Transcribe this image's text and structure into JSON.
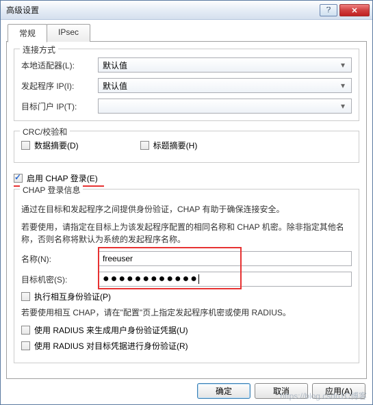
{
  "window": {
    "title": "高级设置"
  },
  "tabs": {
    "t1": "常规",
    "t2": "IPsec"
  },
  "connect": {
    "legend": "连接方式",
    "adapter_label": "本地适配器(L):",
    "initiator_label": "发起程序 IP(I):",
    "target_label": "目标门户 IP(T):",
    "default_value": "默认值"
  },
  "crc": {
    "legend": "CRC/校验和",
    "data_digest": "数据摘要(D)",
    "header_digest": "标题摘要(H)"
  },
  "chap": {
    "enable": "启用 CHAP 登录(E)",
    "group_legend": "CHAP 登录信息",
    "desc1": "通过在目标和发起程序之间提供身份验证，CHAP 有助于确保连接安全。",
    "desc2": "若要使用，请指定在目标上为该发起程序配置的相同名称和 CHAP 机密。除非指定其他名称，否则名称将默认为系统的发起程序名称。",
    "name_label": "名称(N):",
    "name_value": "freeuser",
    "secret_label": "目标机密(S):",
    "secret_value": "●●●●●●●●●●●●",
    "mutual": "执行相互身份验证(P)",
    "mutual_desc": "若要使用相互 CHAP，请在\"配置\"页上指定发起程序机密或使用 RADIUS。",
    "radius1": "使用 RADIUS 来生成用户身份验证凭据(U)",
    "radius2": "使用 RADIUS 对目标凭据进行身份验证(R)"
  },
  "buttons": {
    "ok": "确定",
    "cancel": "取消",
    "apply": "应用(A)"
  },
  "watermark": "https://blog.csdn1C博客"
}
